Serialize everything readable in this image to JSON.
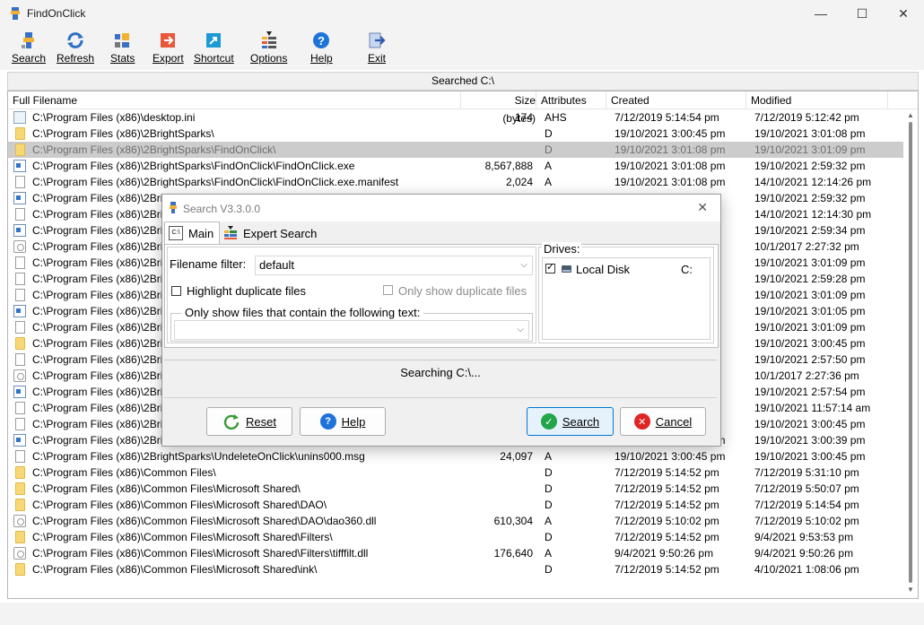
{
  "window": {
    "title": "FindOnClick",
    "minimize": "—",
    "maximize": "☐",
    "close": "✕"
  },
  "toolbar": [
    {
      "label": "Search",
      "icon": "search-icon"
    },
    {
      "label": "Refresh",
      "icon": "refresh-icon"
    },
    {
      "label": "Stats",
      "icon": "stats-icon"
    },
    {
      "label": "Export",
      "icon": "export-icon"
    },
    {
      "label": "Shortcut",
      "icon": "shortcut-icon"
    },
    {
      "label": "Options",
      "icon": "options-icon"
    },
    {
      "label": "Help",
      "icon": "help-icon"
    },
    {
      "label": "Exit",
      "icon": "exit-icon"
    }
  ],
  "search_status": "Searched C:\\",
  "columns": [
    "Full Filename",
    "Size (bytes)",
    "Attributes",
    "Created",
    "Modified"
  ],
  "rows": [
    {
      "icon": "ini",
      "name": "C:\\Program Files (x86)\\desktop.ini",
      "size": "174",
      "attr": "AHS",
      "created": "7/12/2019 5:14:54 pm",
      "modified": "7/12/2019 5:12:42 pm"
    },
    {
      "icon": "folder",
      "name": "C:\\Program Files (x86)\\2BrightSparks\\",
      "size": "",
      "attr": "D",
      "created": "19/10/2021 3:00:45 pm",
      "modified": "19/10/2021 3:01:08 pm"
    },
    {
      "icon": "folder",
      "name": "C:\\Program Files (x86)\\2BrightSparks\\FindOnClick\\",
      "size": "",
      "attr": "D",
      "created": "19/10/2021 3:01:08 pm",
      "modified": "19/10/2021 3:01:09 pm",
      "selected": true
    },
    {
      "icon": "exe",
      "name": "C:\\Program Files (x86)\\2BrightSparks\\FindOnClick\\FindOnClick.exe",
      "size": "8,567,888",
      "attr": "A",
      "created": "19/10/2021 3:01:08 pm",
      "modified": "19/10/2021 2:59:32 pm"
    },
    {
      "icon": "doc",
      "name": "C:\\Program Files (x86)\\2BrightSparks\\FindOnClick\\FindOnClick.exe.manifest",
      "size": "2,024",
      "attr": "A",
      "created": "19/10/2021 3:01:08 pm",
      "modified": "14/10/2021 12:14:26 pm"
    },
    {
      "icon": "exe",
      "name": "C:\\Program Files (x86)\\2Bri",
      "size": "",
      "attr": "",
      "created": "",
      "modified": "19/10/2021 2:59:32 pm"
    },
    {
      "icon": "doc",
      "name": "C:\\Program Files (x86)\\2Bri",
      "size": "",
      "attr": "",
      "created": "",
      "modified": "14/10/2021 12:14:30 pm"
    },
    {
      "icon": "exe",
      "name": "C:\\Program Files (x86)\\2Bri",
      "size": "",
      "attr": "",
      "created": "",
      "modified": "19/10/2021 2:59:34 pm"
    },
    {
      "icon": "dll",
      "name": "C:\\Program Files (x86)\\2Bri",
      "size": "",
      "attr": "",
      "created": "",
      "modified": "10/1/2017 2:27:32 pm"
    },
    {
      "icon": "doc",
      "name": "C:\\Program Files (x86)\\2Bri",
      "size": "",
      "attr": "",
      "created": "",
      "modified": "19/10/2021 3:01:09 pm"
    },
    {
      "icon": "doc",
      "name": "C:\\Program Files (x86)\\2Bri",
      "size": "",
      "attr": "",
      "created": "",
      "modified": "19/10/2021 2:59:28 pm"
    },
    {
      "icon": "doc",
      "name": "C:\\Program Files (x86)\\2Bri",
      "size": "",
      "attr": "",
      "created": "",
      "modified": "19/10/2021 3:01:09 pm"
    },
    {
      "icon": "exe",
      "name": "C:\\Program Files (x86)\\2Bri",
      "size": "",
      "attr": "",
      "created": "",
      "modified": "19/10/2021 3:01:05 pm"
    },
    {
      "icon": "doc",
      "name": "C:\\Program Files (x86)\\2Bri",
      "size": "",
      "attr": "",
      "created": "",
      "modified": "19/10/2021 3:01:09 pm"
    },
    {
      "icon": "folder",
      "name": "C:\\Program Files (x86)\\2Bri",
      "size": "",
      "attr": "",
      "created": "",
      "modified": "19/10/2021 3:00:45 pm"
    },
    {
      "icon": "doc",
      "name": "C:\\Program Files (x86)\\2Bri",
      "size": "",
      "attr": "",
      "created": "",
      "modified": "19/10/2021 2:57:50 pm"
    },
    {
      "icon": "dll",
      "name": "C:\\Program Files (x86)\\2Bri",
      "size": "",
      "attr": "",
      "created": "",
      "modified": "10/1/2017 2:27:36 pm"
    },
    {
      "icon": "exe",
      "name": "C:\\Program Files (x86)\\2Bri",
      "size": "",
      "attr": "",
      "created": "",
      "modified": "19/10/2021 2:57:54 pm"
    },
    {
      "icon": "doc",
      "name": "C:\\Program Files (x86)\\2Bri",
      "size": "",
      "attr": "",
      "created": "",
      "modified": "19/10/2021 11:57:14 am"
    },
    {
      "icon": "doc",
      "name": "C:\\Program Files (x86)\\2Bri",
      "size": "",
      "attr": "",
      "created": "",
      "modified": "19/10/2021 3:00:45 pm"
    },
    {
      "icon": "exe",
      "name": "C:\\Program Files (x86)\\2BrightSparks\\UndeleteOnClick\\unins000.exe",
      "size": "3,366,480",
      "attr": "A",
      "created": "19/10/2021 3:00:45 pm",
      "modified": "19/10/2021 3:00:39 pm"
    },
    {
      "icon": "doc",
      "name": "C:\\Program Files (x86)\\2BrightSparks\\UndeleteOnClick\\unins000.msg",
      "size": "24,097",
      "attr": "A",
      "created": "19/10/2021 3:00:45 pm",
      "modified": "19/10/2021 3:00:45 pm"
    },
    {
      "icon": "folder",
      "name": "C:\\Program Files (x86)\\Common Files\\",
      "size": "",
      "attr": "D",
      "created": "7/12/2019 5:14:52 pm",
      "modified": "7/12/2019 5:31:10 pm"
    },
    {
      "icon": "folder",
      "name": "C:\\Program Files (x86)\\Common Files\\Microsoft Shared\\",
      "size": "",
      "attr": "D",
      "created": "7/12/2019 5:14:52 pm",
      "modified": "7/12/2019 5:50:07 pm"
    },
    {
      "icon": "folder",
      "name": "C:\\Program Files (x86)\\Common Files\\Microsoft Shared\\DAO\\",
      "size": "",
      "attr": "D",
      "created": "7/12/2019 5:14:52 pm",
      "modified": "7/12/2019 5:14:54 pm"
    },
    {
      "icon": "dll",
      "name": "C:\\Program Files (x86)\\Common Files\\Microsoft Shared\\DAO\\dao360.dll",
      "size": "610,304",
      "attr": "A",
      "created": "7/12/2019 5:10:02 pm",
      "modified": "7/12/2019 5:10:02 pm"
    },
    {
      "icon": "folder",
      "name": "C:\\Program Files (x86)\\Common Files\\Microsoft Shared\\Filters\\",
      "size": "",
      "attr": "D",
      "created": "7/12/2019 5:14:52 pm",
      "modified": "9/4/2021 9:53:53 pm"
    },
    {
      "icon": "dll",
      "name": "C:\\Program Files (x86)\\Common Files\\Microsoft Shared\\Filters\\tifffilt.dll",
      "size": "176,640",
      "attr": "A",
      "created": "9/4/2021 9:50:26 pm",
      "modified": "9/4/2021 9:50:26 pm"
    },
    {
      "icon": "folder",
      "name": "C:\\Program Files (x86)\\Common Files\\Microsoft Shared\\ink\\",
      "size": "",
      "attr": "D",
      "created": "7/12/2019 5:14:52 pm",
      "modified": "4/10/2021 1:08:06 pm"
    }
  ],
  "dialog": {
    "title": "Search V3.3.0.0",
    "close": "✕",
    "tabs": [
      {
        "label": "Main",
        "badge": "C:\\"
      },
      {
        "label": "Expert Search"
      }
    ],
    "filename_filter_label": "Filename filter:",
    "filename_filter_value": "default",
    "highlight_duplicates_label": "Highlight duplicate files",
    "only_duplicates_label": "Only show duplicate files",
    "contains_text_label": "Only show files that contain the following text:",
    "contains_text_value": "",
    "drives_label": "Drives:",
    "drives": [
      {
        "label": "Local Disk",
        "letter": "C:",
        "checked": true
      }
    ],
    "searching_text": "Searching C:\\...",
    "buttons": {
      "reset": "Reset",
      "help": "Help",
      "search": "Search",
      "cancel": "Cancel"
    }
  }
}
